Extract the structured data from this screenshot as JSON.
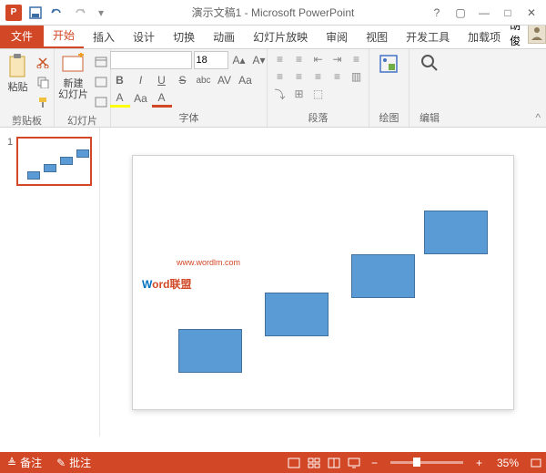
{
  "title": "演示文稿1 - Microsoft PowerPoint",
  "user_name": "胡俊",
  "tabs": {
    "file": "文件",
    "home": "开始",
    "insert": "插入",
    "design": "设计",
    "transitions": "切换",
    "animations": "动画",
    "slideshow": "幻灯片放映",
    "review": "审阅",
    "view": "视图",
    "developer": "开发工具",
    "addins": "加载项"
  },
  "ribbon": {
    "clipboard": {
      "label": "剪贴板",
      "paste": "粘贴"
    },
    "slides": {
      "label": "幻灯片",
      "new_slide": "新建\n幻灯片"
    },
    "font": {
      "label": "字体",
      "size": "18"
    },
    "paragraph": {
      "label": "段落"
    },
    "drawing": {
      "label": "绘图"
    },
    "editing": {
      "label": "编辑"
    }
  },
  "thumb": {
    "num": "1"
  },
  "watermark": {
    "w": "W",
    "ord": "ord",
    "lm": "联盟",
    "url": "www.wordlm.com"
  },
  "status": {
    "notes": "备注",
    "comments": "批注",
    "zoom": "35%"
  }
}
